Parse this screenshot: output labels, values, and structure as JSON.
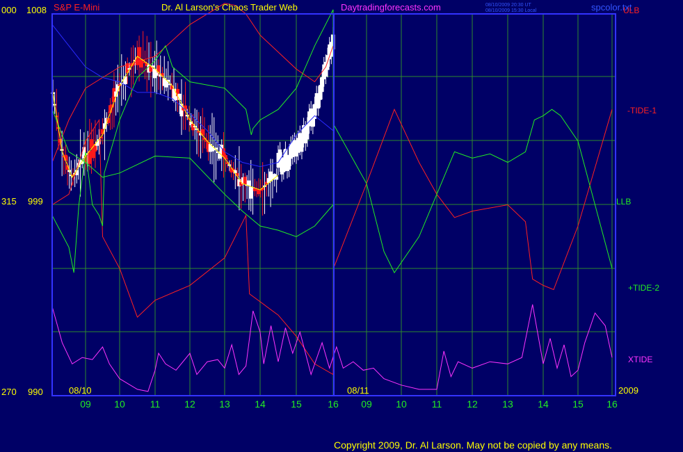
{
  "header": {
    "symbol": "S&P E-Mini",
    "title": "Dr. Al Larson's Chaos Trader Web",
    "site": "Daytradingforecasts.com",
    "time_ut": "08/10/2009 20:30 UT",
    "time_local": "08/10/2009 15:30 Local",
    "file": "spcolor.txt"
  },
  "footer": {
    "copyright": "Copyright 2009, Dr. Al Larson. May not be copied by any means."
  },
  "colors": {
    "background": "#000066",
    "grid": "#2e8a2e",
    "frame": "#3333ff",
    "price_up": "#ffffff",
    "price_down": "#ff1a1a",
    "yellow_line": "#ffff00",
    "blue_line": "#2a2aff",
    "ulb": "#ff2020",
    "tide1": "#ff2020",
    "llb": "#22ee22",
    "tide2": "#22ee22",
    "xtide": "#ff33ff"
  },
  "chart_data": {
    "type": "line",
    "title": "S&P E-Mini",
    "y_axis_left": {
      "labels": [
        {
          "inner": "000",
          "price": "1008"
        },
        {
          "inner": "315",
          "price": "999"
        },
        {
          "inner": "270",
          "price": "990"
        }
      ],
      "range": [
        990,
        1008
      ]
    },
    "x_axis": {
      "hours": [
        "09",
        "10",
        "11",
        "12",
        "13",
        "14",
        "15",
        "16",
        "09",
        "10",
        "11",
        "12",
        "13",
        "14",
        "15",
        "16"
      ],
      "dates": [
        "08/10",
        "08/11"
      ],
      "year": "2009"
    },
    "right_labels": [
      "ULB",
      "-TIDE-1",
      "LLB",
      "+TIDE-2",
      "XTIDE"
    ],
    "grid": true,
    "series": [
      {
        "name": "ULB",
        "key": "ulb",
        "points": [
          [
            0,
            1001
          ],
          [
            0.5,
            1003
          ],
          [
            1,
            1004.5
          ],
          [
            2,
            1005.5
          ],
          [
            3,
            1006
          ],
          [
            4,
            1007.5
          ],
          [
            5,
            1008.5
          ],
          [
            5.3,
            1008.4
          ],
          [
            5.6,
            1008
          ],
          [
            6,
            1007
          ],
          [
            6.5,
            1006.2
          ],
          [
            7,
            1005.4
          ],
          [
            7.5,
            1004.8
          ],
          [
            7.8,
            1005.5
          ],
          [
            8,
            1006.5
          ]
        ]
      },
      {
        "name": "-TIDE-1",
        "key": "tide1",
        "points": [
          [
            0,
            999
          ],
          [
            0.5,
            999.5
          ],
          [
            1,
            1002
          ],
          [
            1.4,
            1003
          ],
          [
            1.5,
            997.5
          ],
          [
            2,
            996
          ],
          [
            2.5,
            993.7
          ],
          [
            3,
            994.5
          ],
          [
            4,
            995.2
          ],
          [
            5,
            996.5
          ],
          [
            5.6,
            998.5
          ],
          [
            5.7,
            994.8
          ],
          [
            6.5,
            993.8
          ],
          [
            7,
            992.8
          ],
          [
            7.5,
            991.5
          ],
          [
            8,
            991
          ],
          [
            8.01,
            996
          ],
          [
            9,
            1000
          ],
          [
            9.8,
            1003.5
          ],
          [
            10.5,
            1001
          ],
          [
            11,
            999.5
          ],
          [
            11.5,
            998.4
          ],
          [
            12,
            998.7
          ],
          [
            13,
            999
          ],
          [
            13.5,
            998.2
          ],
          [
            13.7,
            995.5
          ],
          [
            14,
            995.2
          ],
          [
            14.3,
            995
          ],
          [
            15,
            998
          ],
          [
            16,
            1003.5
          ]
        ]
      },
      {
        "name": "LLB",
        "key": "llb",
        "points": [
          [
            0,
            1003.5
          ],
          [
            0.5,
            1001.5
          ],
          [
            1,
            1001
          ],
          [
            1.5,
            1000.3
          ],
          [
            2,
            1000.5
          ],
          [
            3,
            1001.3
          ],
          [
            4,
            1001.2
          ],
          [
            5,
            999.5
          ],
          [
            5.5,
            998.7
          ],
          [
            6,
            998
          ],
          [
            6.5,
            997.8
          ],
          [
            7,
            997.5
          ],
          [
            7.5,
            998
          ],
          [
            8,
            999
          ]
        ]
      },
      {
        "name": "+TIDE-2",
        "key": "tide2",
        "points": [
          [
            0,
            998.5
          ],
          [
            0.5,
            997
          ],
          [
            0.65,
            995.8
          ],
          [
            0.8,
            999
          ],
          [
            1,
            1001.5
          ],
          [
            1.2,
            999
          ],
          [
            1.4,
            998.5
          ],
          [
            1.5,
            998
          ],
          [
            1.55,
            1000.5
          ],
          [
            2,
            1003
          ],
          [
            2.5,
            1005
          ],
          [
            3,
            1005.8
          ],
          [
            3.3,
            1006.5
          ],
          [
            3.5,
            1005.5
          ],
          [
            4,
            1004.8
          ],
          [
            5,
            1004.5
          ],
          [
            5.6,
            1003.5
          ],
          [
            5.75,
            1002.3
          ],
          [
            5.8,
            1002.6
          ],
          [
            6,
            1003
          ],
          [
            6.5,
            1003.5
          ],
          [
            7,
            1004.5
          ],
          [
            7.5,
            1006.5
          ],
          [
            8,
            1008.2
          ],
          [
            8.01,
            1002.8
          ],
          [
            9,
            1000
          ],
          [
            9.5,
            996.8
          ],
          [
            9.8,
            995.8
          ],
          [
            10.5,
            997.5
          ],
          [
            11,
            999.5
          ],
          [
            11.5,
            1001.5
          ],
          [
            12,
            1001.2
          ],
          [
            12.5,
            1001.4
          ],
          [
            13,
            1001
          ],
          [
            13.5,
            1001.5
          ],
          [
            13.75,
            1003
          ],
          [
            14,
            1003.2
          ],
          [
            14.25,
            1003.5
          ],
          [
            14.5,
            1003.2
          ],
          [
            15,
            1002
          ],
          [
            15.5,
            999
          ],
          [
            16,
            996
          ]
        ]
      },
      {
        "name": "XTIDE",
        "key": "xtide",
        "points": [
          [
            0,
            994.2
          ],
          [
            0.3,
            992.5
          ],
          [
            0.6,
            991.5
          ],
          [
            0.9,
            991.8
          ],
          [
            1.2,
            991.7
          ],
          [
            1.5,
            992.3
          ],
          [
            1.7,
            991.5
          ],
          [
            2,
            990.8
          ],
          [
            2.5,
            990.3
          ],
          [
            2.8,
            990.2
          ],
          [
            3,
            991.2
          ],
          [
            3.1,
            992
          ],
          [
            3.3,
            991.5
          ],
          [
            3.6,
            991.2
          ],
          [
            4,
            992
          ],
          [
            4.2,
            991
          ],
          [
            4.5,
            991.6
          ],
          [
            4.8,
            991.7
          ],
          [
            5,
            991.3
          ],
          [
            5.2,
            992.4
          ],
          [
            5.4,
            991
          ],
          [
            5.6,
            991.4
          ],
          [
            5.8,
            994
          ],
          [
            6,
            993
          ],
          [
            6.1,
            991.5
          ],
          [
            6.3,
            993.3
          ],
          [
            6.5,
            991.6
          ],
          [
            6.7,
            993.2
          ],
          [
            6.9,
            992
          ],
          [
            7.1,
            993
          ],
          [
            7.4,
            991
          ],
          [
            7.7,
            992.5
          ],
          [
            7.9,
            991.3
          ],
          [
            8.1,
            992.3
          ],
          [
            8.3,
            991.3
          ],
          [
            8.6,
            991.6
          ],
          [
            8.9,
            991.2
          ],
          [
            9.2,
            991.3
          ],
          [
            9.5,
            990.8
          ],
          [
            10,
            990.5
          ],
          [
            10.5,
            990.3
          ],
          [
            11,
            990.3
          ],
          [
            11.2,
            992.1
          ],
          [
            11.4,
            990.9
          ],
          [
            11.6,
            991.6
          ],
          [
            12,
            991.3
          ],
          [
            12.5,
            991.6
          ],
          [
            13,
            991.5
          ],
          [
            13.4,
            991.8
          ],
          [
            13.7,
            994.3
          ],
          [
            14,
            991.5
          ],
          [
            14.2,
            992.7
          ],
          [
            14.4,
            991.3
          ],
          [
            14.6,
            992.4
          ],
          [
            14.8,
            990.9
          ],
          [
            15,
            991.2
          ],
          [
            15.2,
            992.5
          ],
          [
            15.5,
            993.9
          ],
          [
            15.8,
            993.3
          ],
          [
            16,
            991.8
          ]
        ]
      },
      {
        "name": "price-yellow",
        "key": "yellow_line",
        "points": [
          [
            0,
            1004.5
          ],
          [
            0.3,
            1001.5
          ],
          [
            0.6,
            1000.3
          ],
          [
            1,
            1001.3
          ],
          [
            1.5,
            1002.3
          ],
          [
            2,
            1004.6
          ],
          [
            2.5,
            1006
          ],
          [
            3,
            1005.4
          ],
          [
            3.5,
            1004.6
          ],
          [
            4,
            1003
          ],
          [
            4.5,
            1002
          ],
          [
            5,
            1001.2
          ],
          [
            5.5,
            1000
          ],
          [
            6,
            999.7
          ],
          [
            6.5,
            1000.4
          ]
        ]
      },
      {
        "name": "price-blue",
        "key": "blue_line",
        "points": [
          [
            0,
            1007.5
          ],
          [
            0.5,
            1006.5
          ],
          [
            1,
            1005.5
          ],
          [
            1.5,
            1005
          ],
          [
            2,
            1004.8
          ],
          [
            2.5,
            1004.3
          ],
          [
            3,
            1004.3
          ],
          [
            3.5,
            1004
          ],
          [
            4,
            1003.3
          ],
          [
            4.5,
            1002.5
          ],
          [
            5,
            1001.5
          ],
          [
            5.5,
            1001
          ],
          [
            6,
            1000.8
          ],
          [
            6.5,
            1001
          ],
          [
            7,
            1002.3
          ],
          [
            7.5,
            1003.2
          ],
          [
            8,
            1002.5
          ]
        ]
      }
    ]
  }
}
